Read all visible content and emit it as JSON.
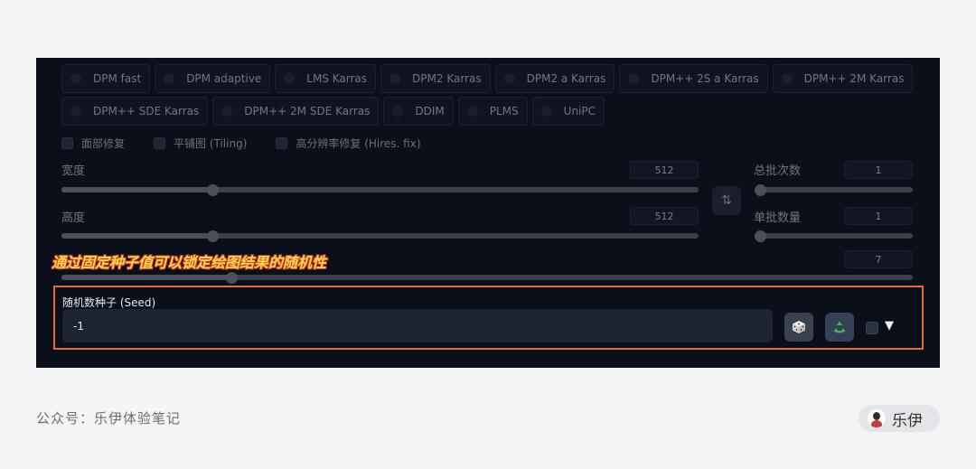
{
  "samplers": {
    "row1": [
      "DPM fast",
      "DPM adaptive",
      "LMS Karras",
      "DPM2 Karras",
      "DPM2 a Karras",
      "DPM++ 2S a Karras",
      "DPM++ 2M Karras"
    ],
    "row2": [
      "DPM++ SDE Karras",
      "DPM++ 2M SDE Karras",
      "DDIM",
      "PLMS",
      "UniPC"
    ]
  },
  "options": {
    "restore_faces": "面部修复",
    "tiling": "平铺图 (Tiling)",
    "hires_fix": "高分辨率修复 (Hires. fix)"
  },
  "width": {
    "label": "宽度",
    "value": "512",
    "fraction": 0.237
  },
  "height": {
    "label": "高度",
    "value": "512",
    "fraction": 0.237
  },
  "batch_count": {
    "label": "总批次数",
    "value": "1",
    "fraction": 0.0
  },
  "batch_size": {
    "label": "单批数量",
    "value": "1",
    "fraction": 0.0
  },
  "cfg": {
    "value": "7",
    "fraction": 0.2
  },
  "swap_icon": "swap-vertical-icon",
  "annotation": "通过固定种子值可以锁定绘图结果的随机性",
  "seed": {
    "label": "随机数种子 (Seed)",
    "value": "-1",
    "dice_icon": "dice-icon",
    "recycle_icon": "recycle-icon",
    "arrow": "▼"
  },
  "footer": {
    "account": "公众号：乐伊体验笔记",
    "author": "乐伊"
  },
  "colors": {
    "panel_bg": "#0b0f19",
    "highlight_border": "#ea6a2f",
    "annotation_text": "#ffd84a",
    "recycle_green": "#3dbb5a"
  }
}
